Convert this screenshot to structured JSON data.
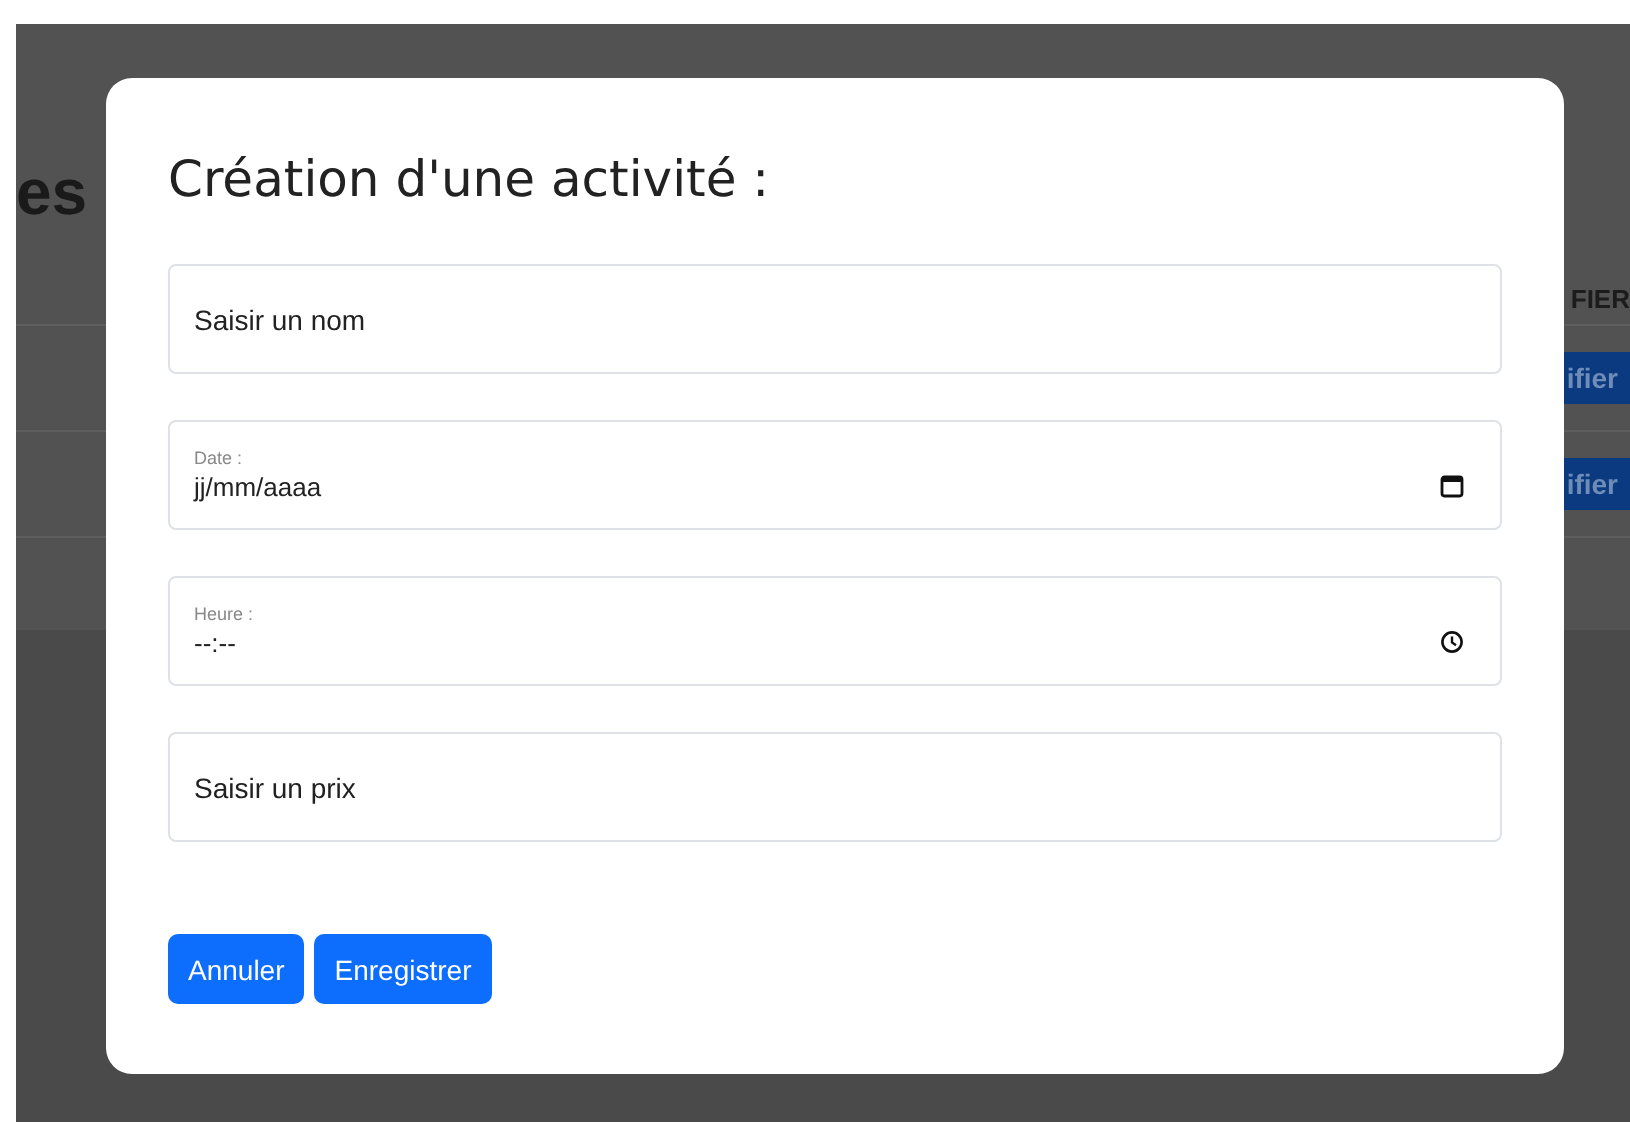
{
  "background": {
    "heading": "es",
    "column_header": "FIER",
    "row_buttons": [
      "ifier",
      "ifier"
    ]
  },
  "modal": {
    "title": "Création d'une activité :",
    "fields": [
      {
        "kind": "text",
        "placeholder": "Saisir un nom"
      },
      {
        "kind": "date",
        "label": "Date :",
        "value": "jj/mm/aaaa"
      },
      {
        "kind": "time",
        "label": "Heure :",
        "value": "--:--"
      },
      {
        "kind": "text",
        "placeholder": "Saisir un prix"
      }
    ],
    "buttons": [
      "Annuler",
      "Enregistrer"
    ]
  }
}
